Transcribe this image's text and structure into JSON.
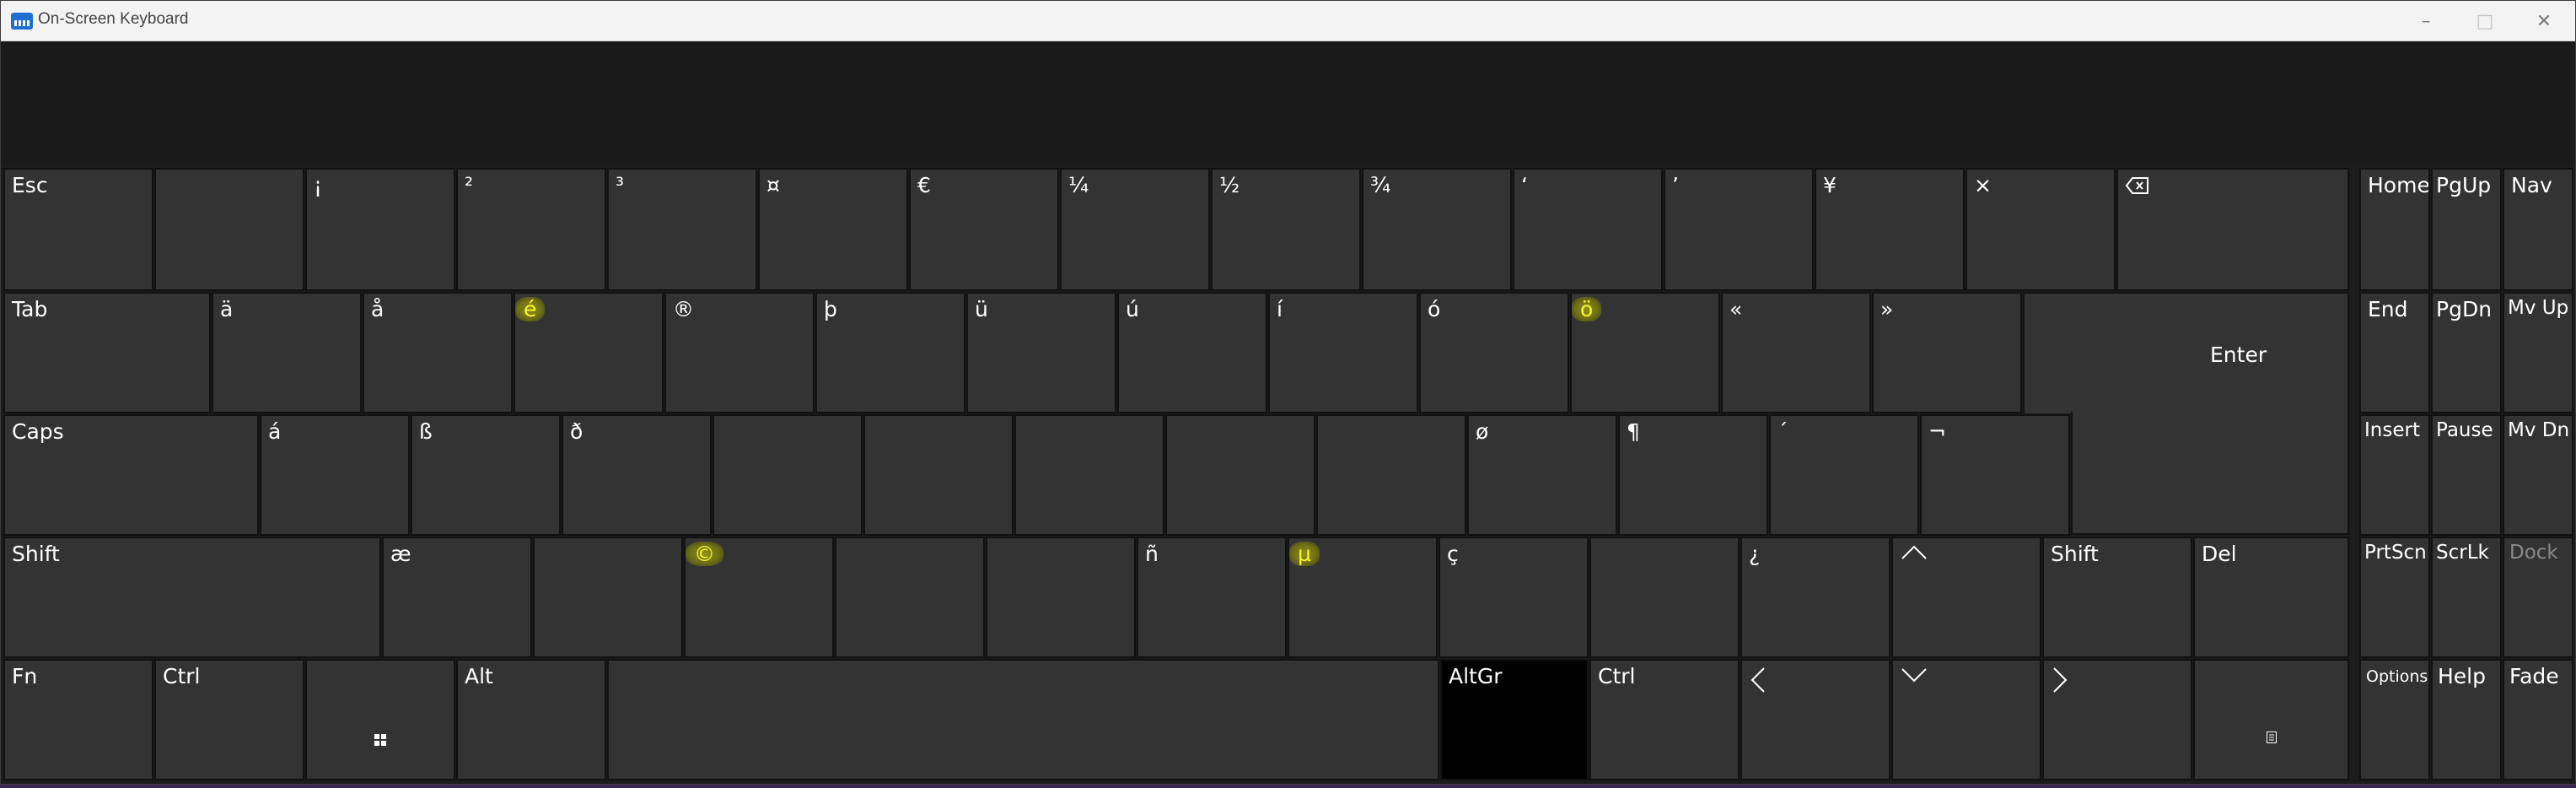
{
  "window": {
    "title": "On-Screen Keyboard",
    "controls": {
      "minimize": "–",
      "maximize": "□",
      "close": "✕"
    }
  },
  "keys": {
    "esc": "Esc",
    "k1": "¡",
    "k2": "²",
    "k3": "³",
    "k4": "¤",
    "k5": "€",
    "k6": "¼",
    "k7": "½",
    "k8": "¾",
    "k9": "‘",
    "k0": "’",
    "kminus": "¥",
    "kequal": "×",
    "tab": "Tab",
    "q": "ä",
    "w": "å",
    "e": "é",
    "r": "®",
    "t": "þ",
    "y": "ü",
    "u": "ú",
    "i": "í",
    "o": "ó",
    "p": "ö",
    "lbracket": "«",
    "rbracket": "»",
    "enter": "Enter",
    "caps": "Caps",
    "a": "á",
    "s": "ß",
    "d": "ð",
    "l": "ø",
    "semicolon": "¶",
    "quote": "´",
    "backslash": "¬",
    "lshift": "Shift",
    "z": "æ",
    "c": "©",
    "n": "ñ",
    "m": "µ",
    "comma": "ç",
    "slash": "¿",
    "rshift": "Shift",
    "del": "Del",
    "fn": "Fn",
    "lctrl": "Ctrl",
    "alt": "Alt",
    "altgr": "AltGr",
    "rctrl": "Ctrl"
  },
  "nav": {
    "home": "Home",
    "pgup": "PgUp",
    "navkey": "Nav",
    "end": "End",
    "pgdn": "PgDn",
    "mvup": "Mv Up",
    "insert": "Insert",
    "pause": "Pause",
    "mvdn": "Mv Dn",
    "prtscn": "PrtScn",
    "scrlk": "ScrLk",
    "dock": "Dock",
    "options": "Options",
    "help": "Help",
    "fade": "Fade"
  },
  "icons": {
    "backspace": "backspace-icon",
    "windows": "windows-logo-icon",
    "up": "arrow-up-icon",
    "left": "arrow-left-icon",
    "down": "arrow-down-icon",
    "right": "arrow-right-icon",
    "menu": "context-menu-icon"
  },
  "colors": {
    "key_bg": "#333333",
    "key_border": "#111111",
    "highlight": "#f5f536",
    "altgr_active": "#000000"
  }
}
